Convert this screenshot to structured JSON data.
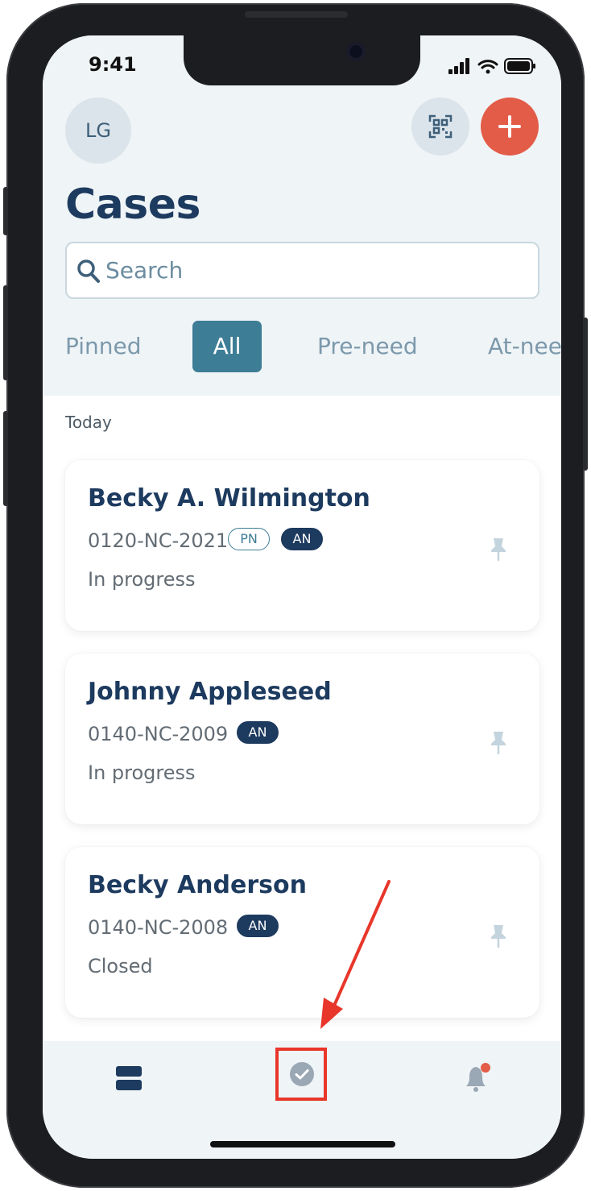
{
  "status_bar": {
    "time": "9:41"
  },
  "header": {
    "avatar_initials": "LG",
    "title": "Cases",
    "qr_icon": "qr-scan-icon",
    "add_icon": "plus-icon",
    "add_color": "#e35c48"
  },
  "search": {
    "placeholder": "Search"
  },
  "tabs": [
    {
      "label": "Pinned",
      "active": false
    },
    {
      "label": "All",
      "active": true
    },
    {
      "label": "Pre-need",
      "active": false
    },
    {
      "label": "At-need",
      "active": false
    }
  ],
  "section_label": "Today",
  "cases": [
    {
      "name": "Becky A. Wilmington",
      "id": "0120-NC-2021",
      "badges": [
        "PN",
        "AN"
      ],
      "status": "In progress"
    },
    {
      "name": "Johnny Appleseed",
      "id": "0140-NC-2009",
      "badges": [
        "AN"
      ],
      "status": "In progress"
    },
    {
      "name": "Becky Anderson",
      "id": "0140-NC-2008",
      "badges": [
        "AN"
      ],
      "status": "Closed"
    }
  ],
  "bottom_nav": [
    {
      "icon": "cases-stack-icon",
      "active": true
    },
    {
      "icon": "check-circle-icon",
      "active": false,
      "highlighted": true
    },
    {
      "icon": "bell-icon",
      "has_notification": true
    }
  ],
  "colors": {
    "primary": "#1d3a5f",
    "accent": "#3e7d96",
    "highlight": "#e8362a",
    "background": "#eff4f6"
  }
}
